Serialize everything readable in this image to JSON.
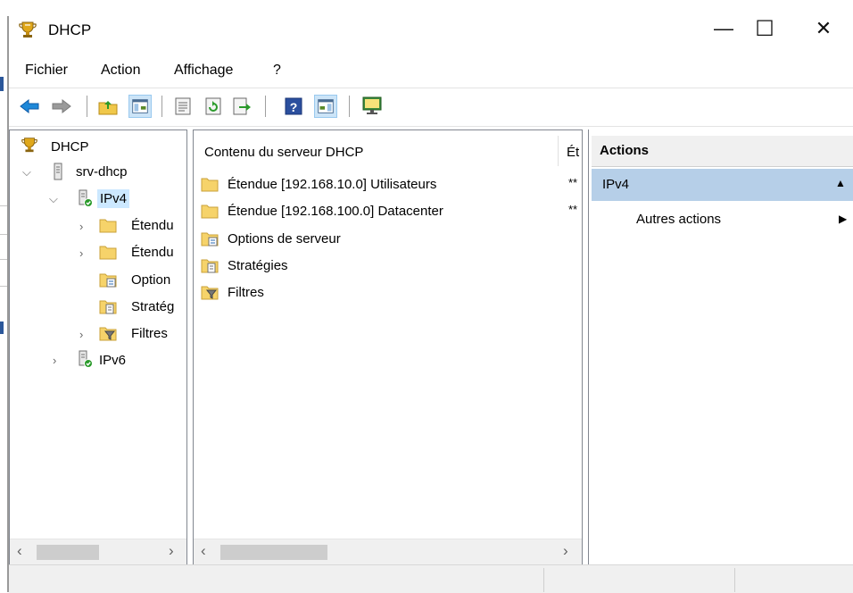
{
  "window": {
    "title": "DHCP",
    "minimize_glyph": "—",
    "maximize_glyph": "☐",
    "close_glyph": "✕",
    "icon": "dhcp-trophy-icon"
  },
  "menu": [
    "Fichier",
    "Action",
    "Affichage",
    "?"
  ],
  "toolbar": {
    "icons": [
      "back-arrow-icon",
      "forward-arrow-icon",
      "up-folder-icon",
      "show-hide-tree-icon",
      "properties-icon",
      "refresh-icon",
      "export-list-icon",
      "help-icon",
      "show-hide-action-pane-icon",
      "server-monitor-icon"
    ]
  },
  "tree": {
    "root": "DHCP",
    "server": "srv-dhcp",
    "ipv4": "IPv4",
    "children": [
      "Étendu",
      "Étendu",
      "Option",
      "Stratég",
      "Filtres"
    ],
    "ipv6": "IPv6"
  },
  "content": {
    "header": "Contenu du serveur DHCP",
    "header_col2": "Ét",
    "items": [
      {
        "label": "Étendue [192.168.10.0] Utilisateurs",
        "col2": "**",
        "icon": "folder-icon"
      },
      {
        "label": "Étendue [192.168.100.0] Datacenter",
        "col2": "**",
        "icon": "folder-icon"
      },
      {
        "label": "Options de serveur",
        "col2": "",
        "icon": "server-options-icon"
      },
      {
        "label": "Stratégies",
        "col2": "",
        "icon": "policies-icon"
      },
      {
        "label": "Filtres",
        "col2": "",
        "icon": "filter-icon"
      }
    ]
  },
  "actions": {
    "header": "Actions",
    "section": "IPv4",
    "item": "Autres actions"
  },
  "colors": {
    "selection": "#cce8ff",
    "actions_section": "#b6cfe8",
    "accent": "#2b579a"
  }
}
